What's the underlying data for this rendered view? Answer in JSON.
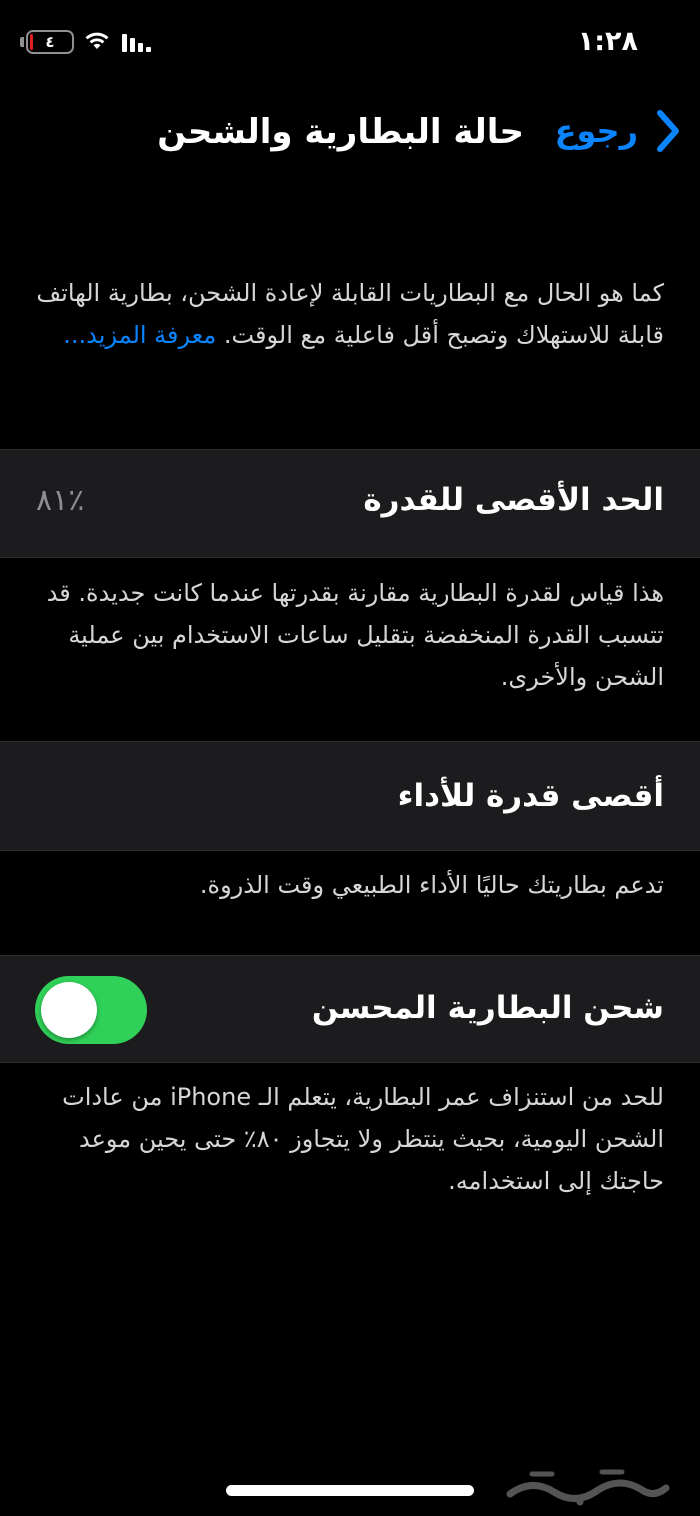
{
  "status_bar": {
    "time": "١:٢٨",
    "battery_level_text": "٤",
    "battery_fraction": 0.08,
    "battery_color": "#e02020",
    "signal_icon": "cellular-signal-icon",
    "wifi_icon": "wifi-icon"
  },
  "nav": {
    "back_label": "رجوع",
    "back_icon": "chevron-back-icon",
    "title": "حالة البطارية والشحن"
  },
  "intro": {
    "text": "كما هو الحال مع البطاريات القابلة لإعادة الشحن، بطارية الهاتف قابلة للاستهلاك وتصبح أقل فاعلية مع الوقت.",
    "link": "معرفة المزيد..."
  },
  "maximum_capacity": {
    "label": "الحد الأقصى للقدرة",
    "value": "٪٨١",
    "percent": 81,
    "footnote": "هذا قياس لقدرة البطارية مقارنة بقدرتها عندما كانت جديدة. قد تتسبب القدرة المنخفضة بتقليل ساعات الاستخدام بين عملية الشحن والأخرى."
  },
  "peak_performance": {
    "label": "أقصى قدرة للأداء",
    "footnote": "تدعم بطاريتك حاليًا الأداء الطبيعي وقت الذروة."
  },
  "optimized_charging": {
    "label": "شحن البطارية المحسن",
    "enabled": true,
    "toggle_color": "#30d158",
    "footnote": "للحد من استنزاف عمر البطارية، يتعلم الـ iPhone من عادات الشحن اليومية، بحيث ينتظر ولا يتجاوز ٨٠٪ حتى يحين موعد حاجتك إلى استخدامه."
  },
  "colors": {
    "accent": "#0a84ff",
    "cell_background": "#1c1c1e",
    "secondary_text": "#8e8e93"
  },
  "watermark": {
    "icon": "haraj-logo",
    "text": "حراج"
  }
}
